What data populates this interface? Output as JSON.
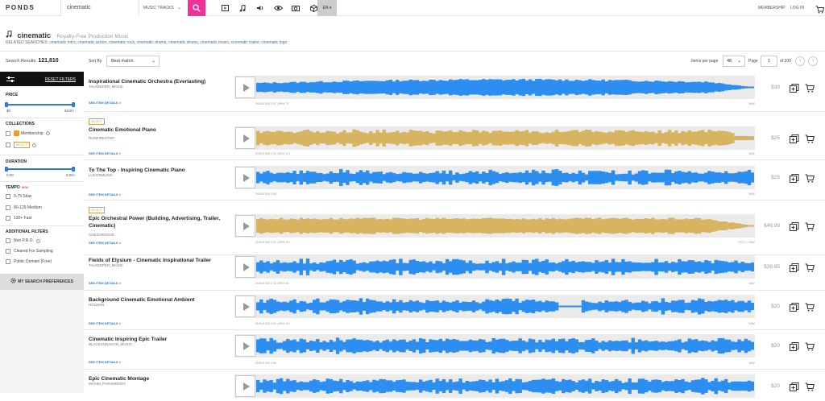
{
  "header": {
    "logo": "PONDS",
    "search_value": "cinematic",
    "search_type": "MUSIC TRACKS",
    "language": "EN",
    "membership": "MEMBERSHIP",
    "login": "LOG IN"
  },
  "page": {
    "query": "cinematic",
    "subtitle": "Royalty-Free Production Music",
    "related_label": "RELATED SEARCHES:",
    "related": [
      "cinematic intro",
      "cinematic action",
      "cinematic rock",
      "cinematic drama",
      "cinematic drums",
      "cinematic music",
      "cinematic trailer",
      "cinematic logo"
    ],
    "results_label": "Search Results:",
    "results_count": "121,810"
  },
  "sidebar": {
    "reset": "RESET FILTERS",
    "price": {
      "label": "PRICE",
      "min": "$0",
      "max": "$100+"
    },
    "collections": {
      "label": "COLLECTIONS",
      "membership": "Membership",
      "select": "SELECT"
    },
    "duration": {
      "label": "DURATION",
      "min": "0:00",
      "max": "5:00+"
    },
    "tempo": {
      "label": "TEMPO",
      "badge": "NEW",
      "options": [
        "0-79 Slow",
        "80-129 Medium",
        "130+ Fast"
      ]
    },
    "additional": {
      "label": "ADDITIONAL FILTERS",
      "options": [
        "Non P.R.O.",
        "Cleared For Sampling",
        "Public Domain (Free)"
      ]
    },
    "prefs": "MY SEARCH PREFERENCES"
  },
  "toolbar": {
    "sort_label": "Sort By",
    "sort_value": "Best match",
    "ipp_label": "Items per page",
    "ipp_value": "48",
    "page_label": "Page",
    "page_value": "1",
    "page_of": "of 200"
  },
  "labels": {
    "see_details": "SEE ITEM DETAILS >",
    "select_badge": "SELECT"
  },
  "colors": {
    "accent": "#f0319a",
    "wave_blue": "#2c8ef0",
    "wave_gold": "#d8b460",
    "link": "#3277c4"
  },
  "tracks": [
    {
      "title": "Inspirational Cinematic Orchestra (Everlasting)",
      "artist": "TALKEEPER_MUSIC",
      "meta": "DURATION 2:37  |  BPM 73",
      "fmt": "WAV",
      "price": "$39",
      "select": false,
      "wave_color": "blue"
    },
    {
      "title": "Cinematic Emotional Piano",
      "artist": "RUNFIRESTOP",
      "meta": "DURATION 2:30  |  BPM 113",
      "fmt": "WAV",
      "price": "$25",
      "select": true,
      "wave_color": "gold"
    },
    {
      "title": "To The Top - Inspiring Cinematic Piano",
      "artist": "LUCORMUSIC",
      "meta": "DURATION 2:55",
      "fmt": "WAV",
      "price": "$25",
      "select": false,
      "wave_color": "blue"
    },
    {
      "title": "Epic Orchestral Power (Building, Advertising, Trailer, Cinematic)",
      "artist": "CHEZGROOVE",
      "meta": "DURATION 2:52  |  BPM 107",
      "fmt": "P.R.O.  |  WAV",
      "price": "$49.99",
      "select": true,
      "wave_color": "gold"
    },
    {
      "title": "Fields of Elysium - Cinematic Inspirational Trailer",
      "artist": "TALKEEPER_MUSIC",
      "meta": "DURATION 2:43  |  BPM 95",
      "fmt": "WAV",
      "price": "$39.95",
      "select": false,
      "wave_color": "blue"
    },
    {
      "title": "Background Cinematic Emotional Ambient",
      "artist": "HOLMAN",
      "meta": "DURATION 3:29  |  BPM 110",
      "fmt": "WAV",
      "price": "$20",
      "select": false,
      "wave_color": "blue"
    },
    {
      "title": "Cinematic Inspiring Epic Trailer",
      "artist": "BLACKSUNAKON_MUSIC",
      "meta": "DURATION 2:50",
      "fmt": "WAV",
      "price": "$20",
      "select": false,
      "wave_color": "blue"
    },
    {
      "title": "Epic Cinematic Montage",
      "artist": "MAXIM_PARAMONOV",
      "meta": "",
      "fmt": "",
      "price": "$20",
      "select": false,
      "wave_color": "blue"
    }
  ]
}
